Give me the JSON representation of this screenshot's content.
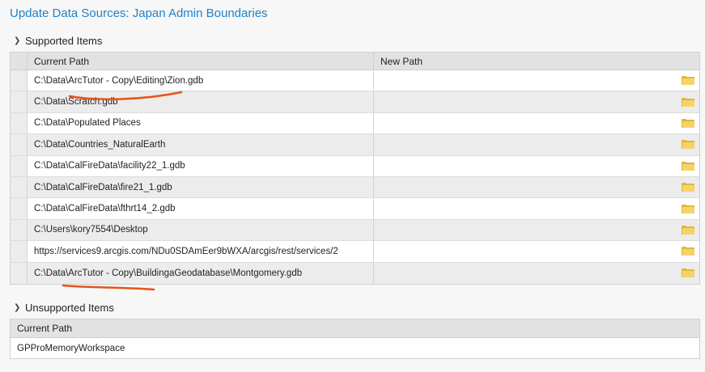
{
  "title": "Update Data Sources: Japan Admin Boundaries",
  "supported": {
    "label": "Supported Items",
    "columns": {
      "current": "Current Path",
      "new": "New Path"
    },
    "rows": [
      {
        "current": "C:\\Data\\ArcTutor - Copy\\Editing\\Zion.gdb",
        "new": ""
      },
      {
        "current": "C:\\Data\\Scratch.gdb",
        "new": ""
      },
      {
        "current": "C:\\Data\\Populated Places",
        "new": ""
      },
      {
        "current": "C:\\Data\\Countries_NaturalEarth",
        "new": ""
      },
      {
        "current": "C:\\Data\\CalFireData\\facility22_1.gdb",
        "new": ""
      },
      {
        "current": "C:\\Data\\CalFireData\\fire21_1.gdb",
        "new": ""
      },
      {
        "current": "C:\\Data\\CalFireData\\fthrt14_2.gdb",
        "new": ""
      },
      {
        "current": "C:\\Users\\kory7554\\Desktop",
        "new": ""
      },
      {
        "current": "https://services9.arcgis.com/NDu0SDAmEer9bWXA/arcgis/rest/services/2",
        "new": ""
      },
      {
        "current": "C:\\Data\\ArcTutor - Copy\\BuildingaGeodatabase\\Montgomery.gdb",
        "new": ""
      }
    ]
  },
  "unsupported": {
    "label": "Unsupported Items",
    "columns": {
      "current": "Current Path"
    },
    "rows": [
      {
        "current": "GPProMemoryWorkspace"
      }
    ]
  },
  "icons": {
    "browse": "folder-icon",
    "collapse": "chevron-down-icon"
  },
  "colors": {
    "title": "#1f82c9",
    "folder": "#e7b437",
    "annotation": "#e8521c"
  }
}
